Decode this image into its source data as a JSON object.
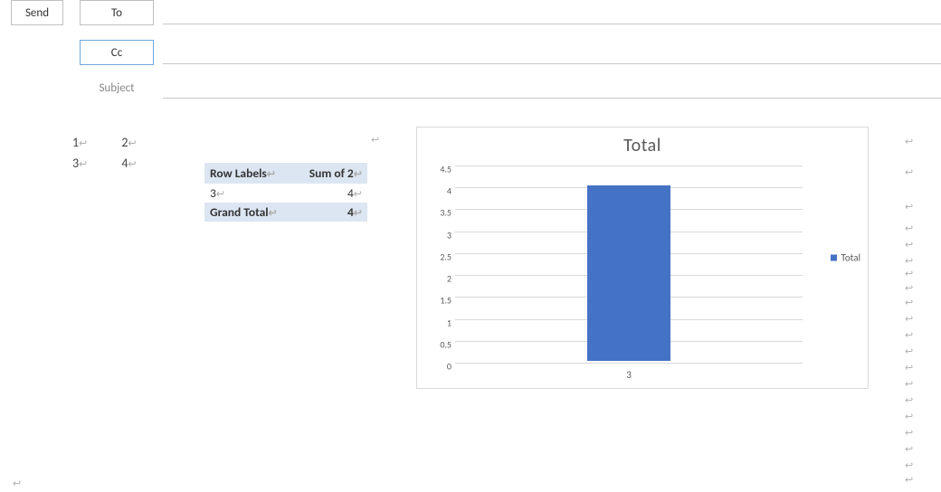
{
  "compose": {
    "send_label": "Send",
    "to_label": "To",
    "cc_label": "Cc",
    "subject_label": "Subject"
  },
  "mini_table": {
    "cells": [
      [
        "1",
        "2"
      ],
      [
        "3",
        "4"
      ]
    ]
  },
  "pivot": {
    "header": {
      "col0": "Row Labels",
      "col1": "Sum of 2"
    },
    "rows": [
      {
        "label": "3",
        "value": "4"
      }
    ],
    "grand": {
      "label": "Grand Total",
      "value": "4"
    }
  },
  "chart_data": {
    "type": "bar",
    "title": "Total",
    "categories": [
      "3"
    ],
    "series": [
      {
        "name": "Total",
        "values": [
          4
        ]
      }
    ],
    "xlabel": "",
    "ylabel": "",
    "ylim": [
      0,
      4.5
    ],
    "yticks": [
      0,
      0.5,
      1,
      1.5,
      2,
      2.5,
      3,
      3.5,
      4,
      4.5
    ],
    "bar_color": "#4472c4"
  }
}
